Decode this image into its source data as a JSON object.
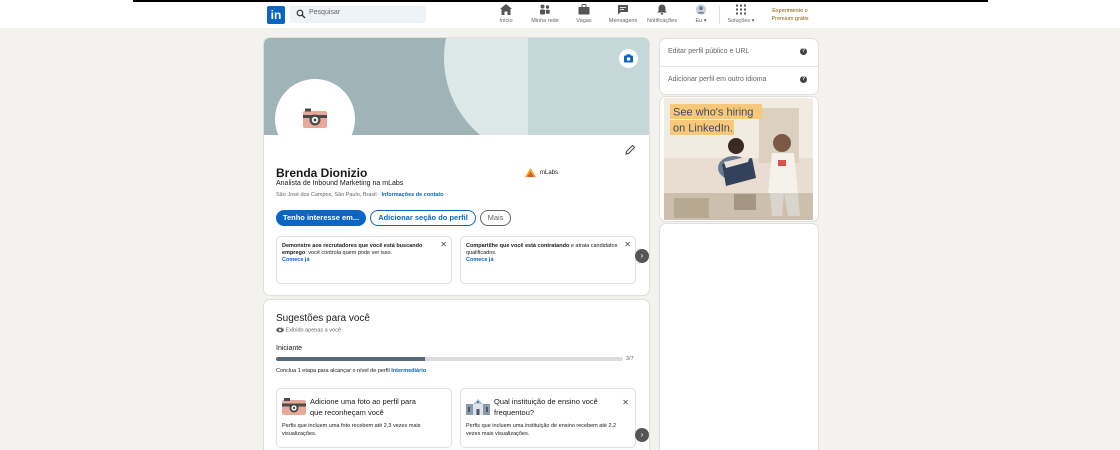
{
  "topbar": {
    "search_placeholder": "Pesquisar",
    "nav": [
      {
        "label": "Início",
        "icon": "home-icon"
      },
      {
        "label": "Minha rede",
        "icon": "network-icon"
      },
      {
        "label": "Vagas",
        "icon": "briefcase-icon"
      },
      {
        "label": "Mensagens",
        "icon": "messaging-icon"
      },
      {
        "label": "Notificações",
        "icon": "bell-icon"
      },
      {
        "label": "Eu ▾",
        "icon": "me-avatar-icon"
      },
      {
        "label": "Soluções ▾",
        "icon": "grid-icon"
      }
    ],
    "premium_line1": "Experimente o",
    "premium_line2": "Premium grátis"
  },
  "profile": {
    "name": "Brenda Dionizio",
    "headline": "Analista de Inbound Marketing na mLabs",
    "location": "São José dos Campos, São Paulo, Brasil · ",
    "contact_link": "Informações de contato",
    "company": "mLabs",
    "buttons": {
      "interest": "Tenho interesse em...",
      "add_section": "Adicionar seção do perfil",
      "more": "Mais"
    },
    "promo1": {
      "text_bold": "Demonstre aos recrutadores que você está buscando emprego",
      "text_rest": ": você controla quem pode ver isso.",
      "cta": "Comece já"
    },
    "promo2": {
      "text_bold": "Compartilhe que você está contratando",
      "text_rest": " e atraia candidatos qualificados.",
      "cta": "Comece já"
    }
  },
  "suggestions": {
    "title": "Sugestões para você",
    "private_note": "Exibido apenas a você",
    "level": "Iniciante",
    "progress_fraction": 0.43,
    "progress_count": "3/7",
    "step_text": "Conclua 1 etapa para alcançar o nível de perfil ",
    "step_link": "Intermediário",
    "card1": {
      "title": "Adicione uma foto ao perfil para que reconheçam você",
      "desc": "Perfis que incluem uma foto recebem até 2,3 vezes mais visualizações."
    },
    "card2": {
      "title": "Qual instituição de ensino você frequentou?",
      "desc": "Perfis que incluem uma instituição de ensino recebem até 2,2 vezes mais visualizações."
    }
  },
  "sidebar": {
    "edit_url": "Editar perfil público e URL",
    "add_language": "Adicionar perfil em outro idioma",
    "ad_line1": "See who's hiring",
    "ad_line2": "on LinkedIn."
  },
  "colors": {
    "brand": "#0a66c2",
    "premium": "#915907",
    "background": "#f3f2ef"
  }
}
